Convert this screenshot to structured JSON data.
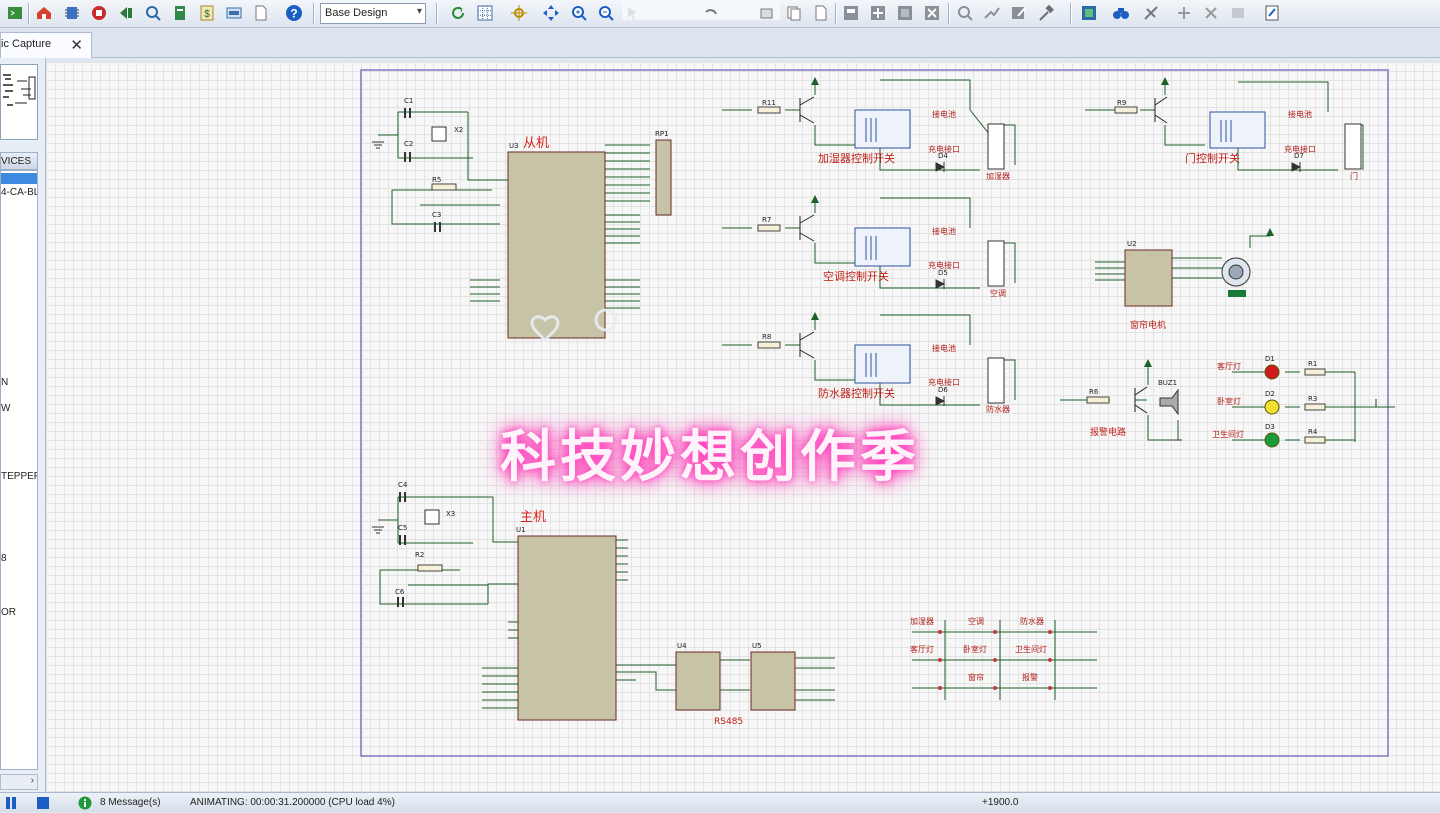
{
  "toolbar": {
    "design_select_value": "Base Design",
    "icons": [
      "terminal-icon",
      "home-icon",
      "components-icon",
      "chip-icon",
      "back-icon",
      "gallery-icon",
      "copy-icon",
      "dollar-icon",
      "tape-icon",
      "document-icon",
      "help-icon",
      "refresh-icon",
      "grid-icon",
      "origin-icon",
      "pan-icon",
      "zoom-in-icon",
      "zoom-out-icon",
      "cursor-icon",
      "undo-icon",
      "cut-icon",
      "copy-doc-icon",
      "block-copy-icon",
      "block-move-icon",
      "block-rotate-icon",
      "block-delete-icon",
      "search-icon",
      "wire-autoroute-icon",
      "edit-icon",
      "hammer-icon",
      "netlist-icon",
      "binoculars-icon",
      "strike-icon",
      "add-icon",
      "remove-icon",
      "tools-icon",
      "notes-icon"
    ]
  },
  "tab": {
    "label": "ic Capture",
    "close": "✕"
  },
  "left_panel": {
    "devices_header": "VICES",
    "devices": [
      "4-CA-BL",
      "N",
      "W",
      "TEPPEF",
      "8",
      "OR"
    ],
    "scroll_arrow": "›"
  },
  "schematic": {
    "slave_label": "从机",
    "master_label": "主机",
    "u3_ref": "U3",
    "u1_ref": "U1",
    "rp1_ref": "RP1",
    "switch_labels": [
      "加湿器控制开关",
      "空调控制开关",
      "防水器控制开关",
      "门控制开关"
    ],
    "relay_pin_labels": [
      "接电池",
      "充电接口"
    ],
    "load_labels": [
      "加湿器",
      "空调",
      "防水器",
      "门"
    ],
    "motor_label": "窗帘电机",
    "alarm_label": "报警电路",
    "buzzer_ref": "BUZ1",
    "u2_ref": "U2",
    "led_labels": [
      "客厅灯",
      "卧室灯",
      "卫生间灯"
    ],
    "rs485_label": "RS485",
    "u4_ref": "U4",
    "u5_ref": "U5",
    "cap_refs": [
      "C1",
      "C2",
      "C3",
      "C4",
      "C5",
      "C6"
    ],
    "crystal_refs": [
      "X2",
      "X3"
    ],
    "resistor_refs": [
      "R5",
      "R2",
      "R11",
      "R7",
      "R8",
      "R9",
      "R6",
      "R1",
      "R3",
      "R4"
    ],
    "diode_refs": [
      "D4",
      "D5",
      "D6",
      "D7"
    ],
    "led_refs": [
      "D1",
      "D2",
      "D3"
    ],
    "key_labels": [
      "加湿器",
      "空调",
      "防水器",
      "客厅灯",
      "卧室灯",
      "卫生间灯",
      "",
      "窗帘",
      "报警"
    ]
  },
  "overlay_text": "科技妙想创作季",
  "status": {
    "messages": "8 Message(s)",
    "animating": "ANIMATING: 00:00:31.200000 (CPU load 4%)",
    "coord": "+1900.0"
  }
}
